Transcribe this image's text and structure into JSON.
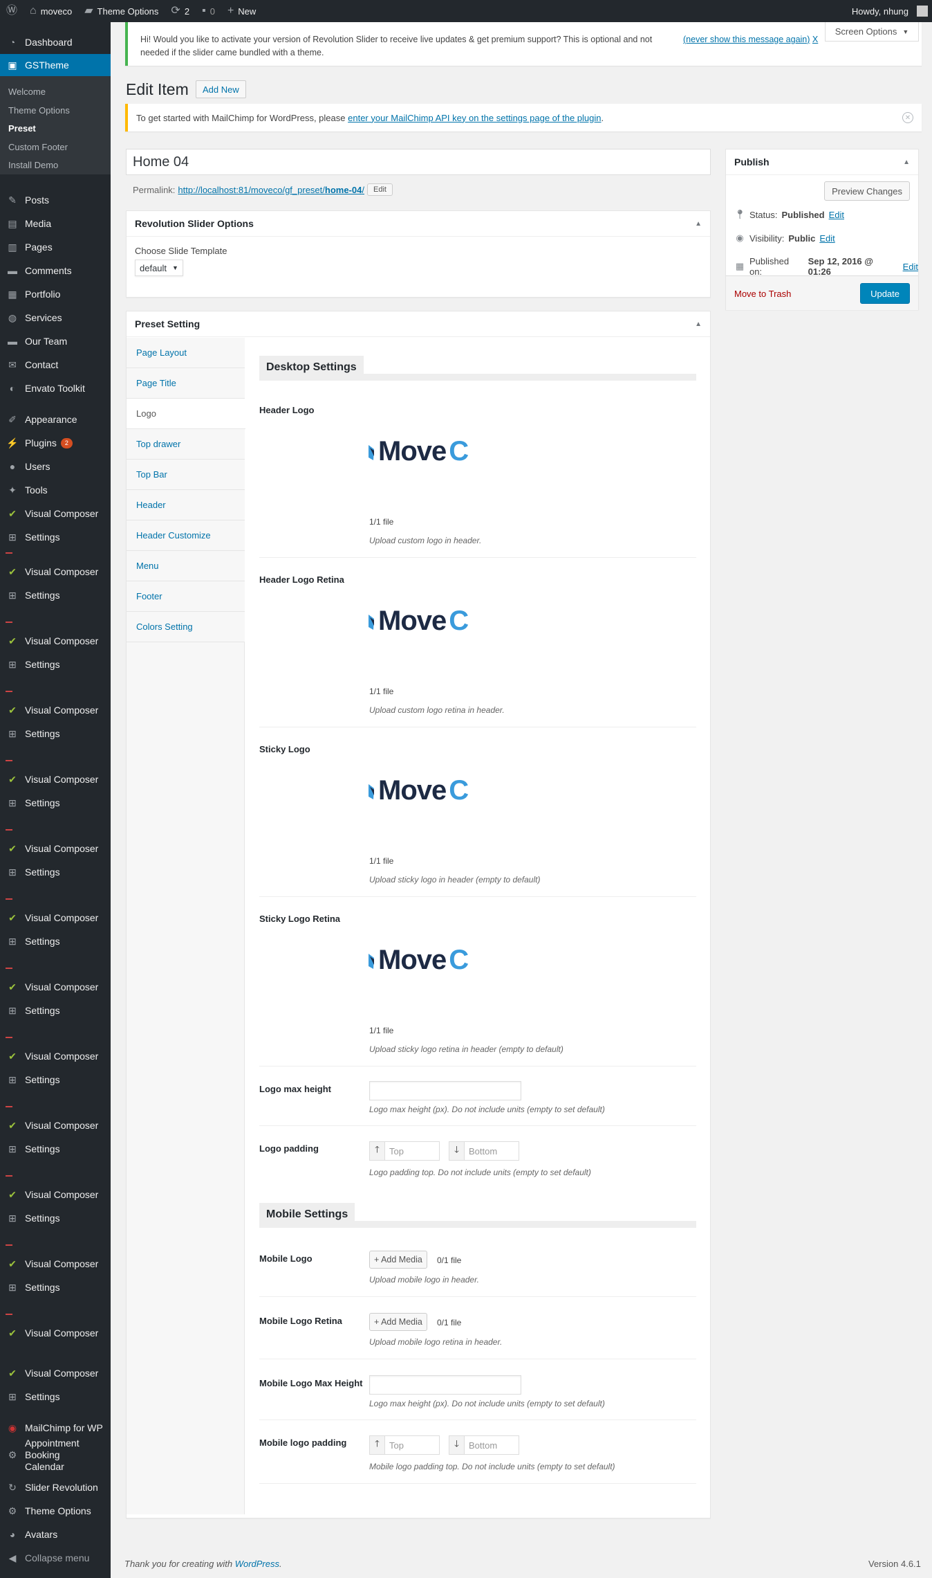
{
  "admin_bar": {
    "site_name": "moveco",
    "theme_options": "Theme Options",
    "updates_count": "2",
    "comments_count": "0",
    "new_label": "New",
    "howdy": "Howdy, nhung"
  },
  "sidebar": {
    "dashboard": "Dashboard",
    "gstheme": "GSTheme",
    "sub": [
      "Welcome",
      "Theme Options",
      "Preset",
      "Custom Footer",
      "Install Demo"
    ],
    "posts": "Posts",
    "media": "Media",
    "pages": "Pages",
    "comments": "Comments",
    "portfolio": "Portfolio",
    "services": "Services",
    "our_team": "Our Team",
    "contact": "Contact",
    "envato": "Envato Toolkit",
    "appearance": "Appearance",
    "plugins": "Plugins",
    "plugins_badge": "2",
    "users": "Users",
    "tools": "Tools",
    "visual_composer": "Visual Composer",
    "settings": "Settings",
    "mailchimp": "MailChimp for WP",
    "appointment": "Appointment Booking Calendar",
    "slider_revolution": "Slider Revolution",
    "theme_options": "Theme Options",
    "avatars": "Avatars",
    "collapse": "Collapse menu"
  },
  "notice_rs": {
    "message": "Hi! Would you like to activate your version of Revolution Slider to receive live updates & get premium support? This is optional and not needed if the slider came bundled with a theme.",
    "dismiss_link": "(never show this message again)",
    "dismiss_x": "X"
  },
  "screen_options": "Screen Options",
  "page": {
    "title": "Edit Item",
    "add_new": "Add New"
  },
  "notice_mc": {
    "prefix": "To get started with MailChimp for WordPress, please",
    "link": "enter your MailChimp API key on the settings page of the plugin",
    "suffix": "."
  },
  "post": {
    "title": "Home 04",
    "permalink_label": "Permalink:",
    "permalink_url": "http://localhost:81/moveco/gf_preset/",
    "permalink_slug": "home-04",
    "permalink_end": "/",
    "edit_btn": "Edit"
  },
  "revslider": {
    "title": "Revolution Slider Options",
    "choose_label": "Choose Slide Template",
    "select_value": "default"
  },
  "preset": {
    "title": "Preset Setting",
    "tabs": [
      "Page Layout",
      "Page Title",
      "Logo",
      "Top drawer",
      "Top Bar",
      "Header",
      "Header Customize",
      "Menu",
      "Footer",
      "Colors Setting"
    ],
    "desktop_heading": "Desktop Settings",
    "mobile_heading": "Mobile Settings",
    "logo_text_main": "Move",
    "logo_text_cut": "C",
    "fields": {
      "header_logo": {
        "label": "Header Logo",
        "count": "1/1 file",
        "desc": "Upload custom logo in header."
      },
      "header_logo_retina": {
        "label": "Header Logo Retina",
        "count": "1/1 file",
        "desc": "Upload custom logo retina in header."
      },
      "sticky_logo": {
        "label": "Sticky Logo",
        "count": "1/1 file",
        "desc": "Upload sticky logo in header (empty to default)"
      },
      "sticky_logo_retina": {
        "label": "Sticky Logo Retina",
        "count": "1/1 file",
        "desc": "Upload sticky logo retina in header (empty to default)"
      },
      "logo_max_height": {
        "label": "Logo max height",
        "desc": "Logo max height (px). Do not include units (empty to set default)"
      },
      "logo_padding": {
        "label": "Logo padding",
        "top": "Top",
        "bottom": "Bottom",
        "desc": "Logo padding top. Do not include units (empty to set default)"
      },
      "mobile_logo": {
        "label": "Mobile Logo",
        "btn": "+ Add Media",
        "count": "0/1 file",
        "desc": "Upload mobile logo in header."
      },
      "mobile_logo_retina": {
        "label": "Mobile Logo Retina",
        "btn": "+ Add Media",
        "count": "0/1 file",
        "desc": "Upload mobile logo retina in header."
      },
      "mobile_logo_max_height": {
        "label": "Mobile Logo Max Height",
        "desc": "Logo max height (px). Do not include units (empty to set default)"
      },
      "mobile_logo_padding": {
        "label": "Mobile logo padding",
        "top": "Top",
        "bottom": "Bottom",
        "desc": "Mobile logo padding top. Do not include units (empty to set default)"
      }
    }
  },
  "publish": {
    "title": "Publish",
    "preview": "Preview Changes",
    "status_label": "Status:",
    "status_value": "Published",
    "visibility_label": "Visibility:",
    "visibility_value": "Public",
    "published_label": "Published on:",
    "published_value": "Sep 12, 2016 @ 01:26",
    "edit": "Edit",
    "trash": "Move to Trash",
    "update": "Update"
  },
  "footer": {
    "thanks": "Thank you for creating with",
    "wp": "WordPress",
    "period": ".",
    "version": "Version 4.6.1"
  }
}
